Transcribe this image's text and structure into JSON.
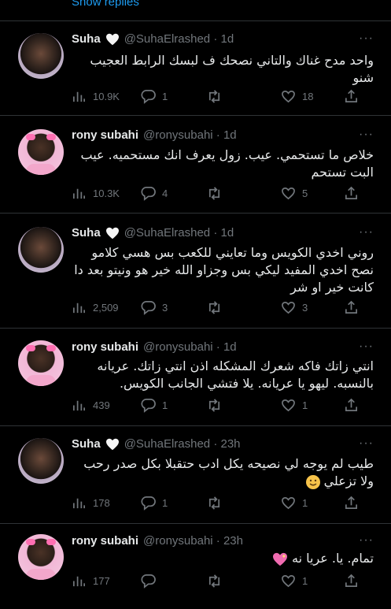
{
  "show_replies": "Show replies",
  "more_glyph": "···",
  "tweets": [
    {
      "name": "Suha",
      "handle": "@SuhaElrashed · 1d",
      "avatar": "suha",
      "text": "واحد مدح غناك والتاني نصحك ف لبسك الرابط العجيب شنو",
      "views": "10.9K",
      "replies": "1",
      "retweets": "",
      "likes": "18"
    },
    {
      "name": "rony subahi",
      "handle": "@ronysubahi · 1d",
      "avatar": "rony",
      "text": "خلاص ما تستحمي. عيب. زول يعرف انك مستحميه. عيب البت تستحم",
      "views": "10.3K",
      "replies": "4",
      "retweets": "",
      "likes": "5"
    },
    {
      "name": "Suha",
      "handle": "@SuhaElrashed · 1d",
      "avatar": "suha",
      "text": "روني اخدي الكويس وما تعايني للكعب بس هسي كلامو نصح اخدي المفيد ليكي بس وجزاو الله خير هو ونيتو بعد دا كانت خير او شر",
      "views": "2,509",
      "replies": "3",
      "retweets": "",
      "likes": "3"
    },
    {
      "name": "rony subahi",
      "handle": "@ronysubahi · 1d",
      "avatar": "rony",
      "text": "انتي زاتك فاكه شعرك المشكله اذن انتي زاتك. عريانه بالنسبه. ليهو يا عريانه. يلا فتشي الجانب الكويس.",
      "views": "439",
      "replies": "1",
      "retweets": "",
      "likes": "1"
    },
    {
      "name": "Suha",
      "handle": "@SuhaElrashed · 23h",
      "avatar": "suha",
      "text": "طيب لم يوجه لي نصيحه يكل ادب حتقبلا بكل صدر رحب ولا تزعلي",
      "views": "178",
      "replies": "1",
      "retweets": "",
      "likes": "1"
    },
    {
      "name": "rony subahi",
      "handle": "@ronysubahi · 23h",
      "avatar": "rony",
      "text": "تمام. يا. عريا نه",
      "views": "177",
      "replies": "",
      "retweets": "",
      "likes": "1"
    }
  ]
}
